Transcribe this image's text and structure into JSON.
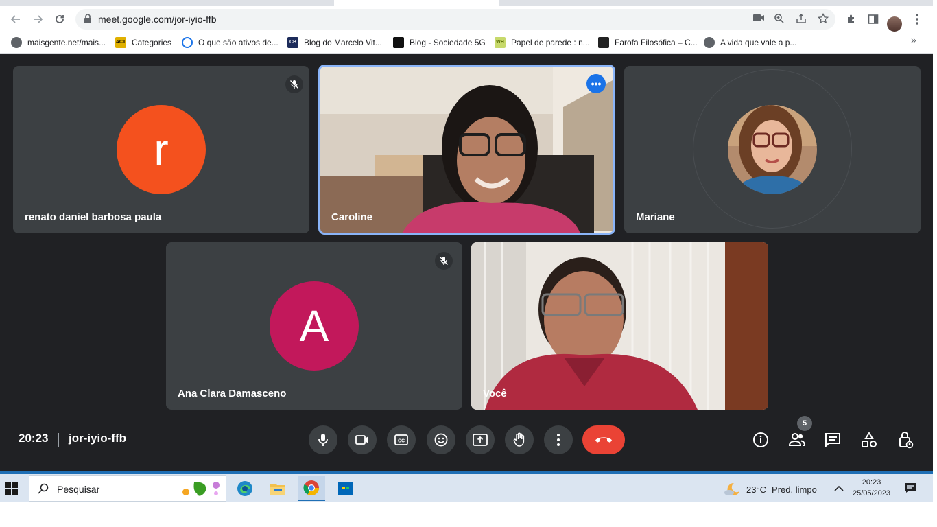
{
  "browser": {
    "url": "meet.google.com/jor-iyio-ffb",
    "bookmarks": [
      {
        "label": "maisgente.net/mais..."
      },
      {
        "label": "Categories"
      },
      {
        "label": "O que são ativos de..."
      },
      {
        "label": "Blog do Marcelo Vit..."
      },
      {
        "label": "Blog - Sociedade 5G"
      },
      {
        "label": "Papel de parede : n..."
      },
      {
        "label": "Farofa Filosófica – C..."
      },
      {
        "label": "A vida que vale a p..."
      }
    ],
    "more_bookmarks": "»"
  },
  "meet": {
    "participants": [
      {
        "name": "renato daniel barbosa paula",
        "initial": "r",
        "color": "#f4511e",
        "muted": true
      },
      {
        "name": "Caroline",
        "video": true,
        "active_speaker": true
      },
      {
        "name": "Mariane",
        "photo": true
      },
      {
        "name": "Ana Clara Damasceno",
        "initial": "A",
        "color": "#c2185b",
        "muted": true
      },
      {
        "name": "Você",
        "video": true
      }
    ],
    "clock": "20:23",
    "meeting_code": "jor-iyio-ffb",
    "people_count": "5",
    "end_call_color": "#ea4335",
    "accent": "#8ab4f8"
  },
  "taskbar": {
    "search_placeholder": "Pesquisar",
    "weather_temp": "23°C",
    "weather_desc": "Pred. limpo",
    "time": "20:23",
    "date": "25/05/2023"
  }
}
